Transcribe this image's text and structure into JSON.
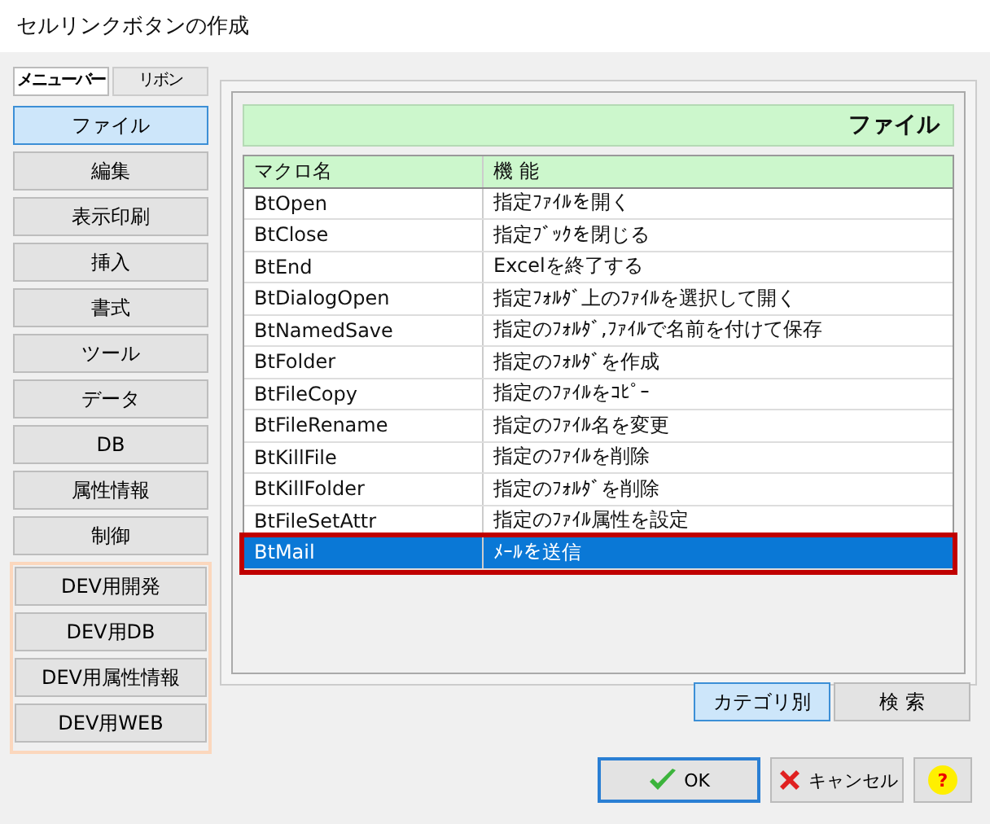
{
  "window": {
    "title": "セルリンクボタンの作成"
  },
  "mode_tabs": [
    {
      "label": "メニューバー",
      "selected": true
    },
    {
      "label": "リボン",
      "selected": false
    }
  ],
  "categories": [
    {
      "label": "ファイル",
      "selected": true,
      "kind": "standard"
    },
    {
      "label": "編集",
      "selected": false,
      "kind": "standard"
    },
    {
      "label": "表示印刷",
      "selected": false,
      "kind": "standard"
    },
    {
      "label": "挿入",
      "selected": false,
      "kind": "standard"
    },
    {
      "label": "書式",
      "selected": false,
      "kind": "standard"
    },
    {
      "label": "ツール",
      "selected": false,
      "kind": "standard"
    },
    {
      "label": "データ",
      "selected": false,
      "kind": "standard"
    },
    {
      "label": "DB",
      "selected": false,
      "kind": "standard"
    },
    {
      "label": "属性情報",
      "selected": false,
      "kind": "standard"
    },
    {
      "label": "制御",
      "selected": false,
      "kind": "standard"
    },
    {
      "label": "DEV用開発",
      "selected": false,
      "kind": "dev"
    },
    {
      "label": "DEV用DB",
      "selected": false,
      "kind": "dev"
    },
    {
      "label": "DEV用属性情報",
      "selected": false,
      "kind": "dev"
    },
    {
      "label": "DEV用WEB",
      "selected": false,
      "kind": "dev"
    }
  ],
  "panel": {
    "heading": "ファイル"
  },
  "table": {
    "columns": [
      "マクロ名",
      "機 能"
    ],
    "rows": [
      {
        "cells": [
          "BtOpen",
          "指定ﾌｧｲﾙを開く"
        ],
        "selected": false
      },
      {
        "cells": [
          "BtClose",
          "指定ﾌﾞｯｸを閉じる"
        ],
        "selected": false
      },
      {
        "cells": [
          "BtEnd",
          "Excelを終了する"
        ],
        "selected": false
      },
      {
        "cells": [
          "BtDialogOpen",
          "指定ﾌｫﾙﾀﾞ上のﾌｧｲﾙを選択して開く"
        ],
        "selected": false
      },
      {
        "cells": [
          "BtNamedSave",
          "指定のﾌｫﾙﾀﾞ,ﾌｧｲﾙで名前を付けて保存"
        ],
        "selected": false
      },
      {
        "cells": [
          "BtFolder",
          "指定のﾌｫﾙﾀﾞを作成"
        ],
        "selected": false
      },
      {
        "cells": [
          "BtFileCopy",
          "指定のﾌｧｲﾙをｺﾋﾟｰ"
        ],
        "selected": false
      },
      {
        "cells": [
          "BtFileRename",
          "指定のﾌｧｲﾙ名を変更"
        ],
        "selected": false
      },
      {
        "cells": [
          "BtKillFile",
          "指定のﾌｧｲﾙを削除"
        ],
        "selected": false
      },
      {
        "cells": [
          "BtKillFolder",
          "指定のﾌｫﾙﾀﾞを削除"
        ],
        "selected": false
      },
      {
        "cells": [
          "BtFileSetAttr",
          "指定のﾌｧｲﾙ属性を設定"
        ],
        "selected": false
      },
      {
        "cells": [
          "BtMail",
          "ﾒｰﾙを送信"
        ],
        "selected": true
      }
    ]
  },
  "view_tabs": [
    {
      "label": "カテゴリ別",
      "selected": true
    },
    {
      "label": "検 索",
      "selected": false
    }
  ],
  "buttons": [
    {
      "label": "OK",
      "kind": "ok"
    },
    {
      "label": "キャンセル",
      "kind": "cancel"
    },
    {
      "label": "?",
      "kind": "help"
    }
  ]
}
